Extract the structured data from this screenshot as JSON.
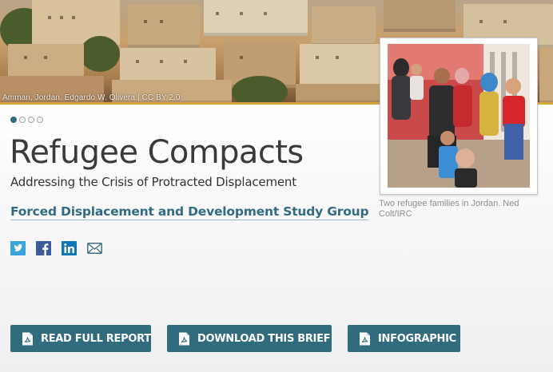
{
  "hero": {
    "caption": "Amman, Jordan. Edgardo W. Olivera | CC BY 2.0"
  },
  "carousel": {
    "dots": [
      true,
      false,
      false,
      false
    ]
  },
  "main": {
    "title": "Refugee Compacts",
    "subtitle": "Addressing the Crisis of Protracted Displacement",
    "study_group": "Forced Displacement and Development Study Group"
  },
  "social": {
    "icons": [
      "twitter-icon",
      "facebook-icon",
      "linkedin-icon",
      "email-icon"
    ]
  },
  "photo": {
    "caption": "Two refugee families in Jordan. Ned Colt/IRC"
  },
  "actions": {
    "read_label": "READ FULL REPORT",
    "download_label": "DOWNLOAD THIS BRIEF",
    "infographic_label": "INFOGRAPHIC"
  },
  "colors": {
    "accent": "#306b7e",
    "link": "#336c80",
    "gold": "#d6a63a",
    "twitter": "#3aa2dc",
    "facebook": "#3b5c98",
    "linkedin": "#0f77b3"
  }
}
